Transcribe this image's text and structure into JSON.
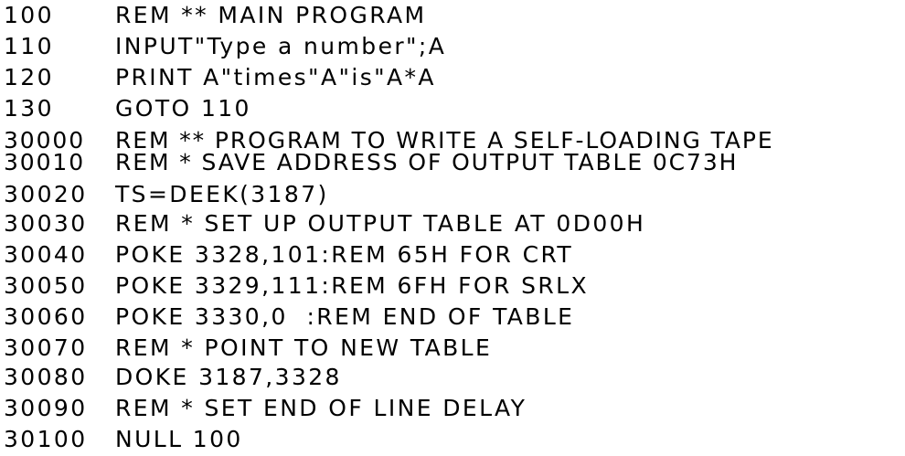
{
  "listing": {
    "lines": [
      {
        "number": "100",
        "text": "REM ** MAIN PROGRAM"
      },
      {
        "number": "110",
        "text": "INPUT\"Type a number\";A"
      },
      {
        "number": "120",
        "text": "PRINT A\"times\"A\"is\"A*A"
      },
      {
        "number": "130",
        "text": "GOTO 110"
      },
      {
        "number": "30000",
        "text": "REM ** PROGRAM TO WRITE A SELF-LOADING TAPE"
      },
      {
        "number": "30010",
        "text": "REM * SAVE ADDRESS OF OUTPUT TABLE 0C73H"
      },
      {
        "number": "30020",
        "text": "TS=DEEK(3187)"
      },
      {
        "number": "30030",
        "text": "REM * SET UP OUTPUT TABLE AT 0D00H"
      },
      {
        "number": "30040",
        "text": "POKE 3328,101:REM 65H FOR CRT"
      },
      {
        "number": "30050",
        "text": "POKE 3329,111:REM 6FH FOR SRLX"
      },
      {
        "number": "30060",
        "text": "POKE 3330,0  :REM END OF TABLE"
      },
      {
        "number": "30070",
        "text": "REM * POINT TO NEW TABLE"
      },
      {
        "number": "30080",
        "text": "DOKE 3187,3328"
      },
      {
        "number": "30090",
        "text": "REM * SET END OF LINE DELAY"
      },
      {
        "number": "30100",
        "text": "NULL 100"
      }
    ]
  }
}
